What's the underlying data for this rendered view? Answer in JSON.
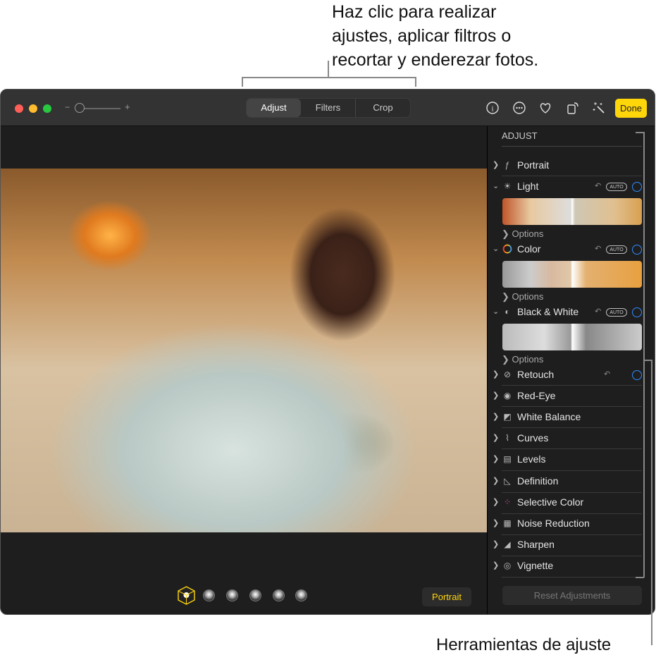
{
  "callout_top": [
    "Haz clic para realizar",
    "ajustes, aplicar filtros o",
    "recortar y enderezar fotos."
  ],
  "callout_bottom": "Herramientas de ajuste",
  "toolbar": {
    "zoom_minus": "−",
    "zoom_plus": "+",
    "tabs": [
      "Adjust",
      "Filters",
      "Crop"
    ],
    "active_tab": "Adjust",
    "done": "Done",
    "icons": [
      "info-icon",
      "more-icon",
      "heart-icon",
      "rotate-icon",
      "magic-wand-icon"
    ]
  },
  "sidebar": {
    "heading": "ADJUST",
    "expanded": [
      {
        "label": "Light",
        "auto": "AUTO",
        "options": "Options"
      },
      {
        "label": "Color",
        "auto": "AUTO",
        "options": "Options"
      },
      {
        "label": "Black & White",
        "auto": "AUTO",
        "options": "Options"
      }
    ],
    "portrait": "Portrait",
    "tools": [
      "Retouch",
      "Red-Eye",
      "White Balance",
      "Curves",
      "Levels",
      "Definition",
      "Selective Color",
      "Noise Reduction",
      "Sharpen",
      "Vignette"
    ],
    "reset": "Reset Adjustments"
  },
  "bottom": {
    "portrait_button": "Portrait",
    "lighting_options": 6
  },
  "colors": {
    "accent": "#ffd60a",
    "ring": "#2f8cff"
  }
}
